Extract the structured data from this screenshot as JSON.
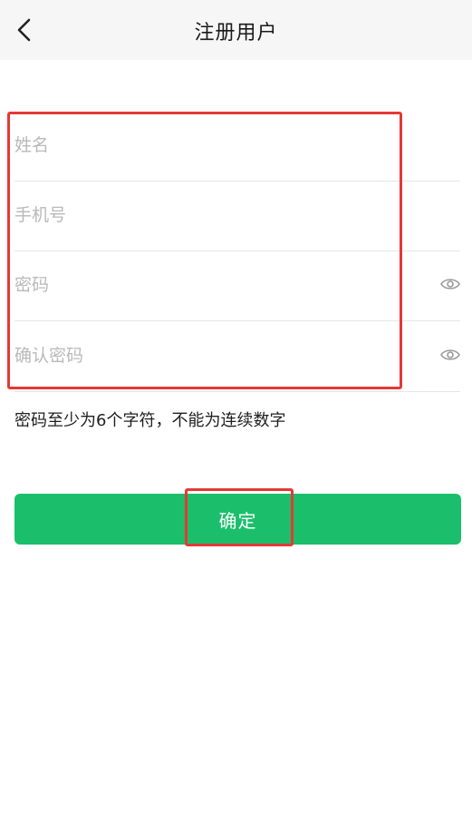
{
  "header": {
    "back_icon": "chevron-left-icon",
    "title": "注册用户"
  },
  "form": {
    "name_placeholder": "姓名",
    "phone_placeholder": "手机号",
    "password_placeholder": "密码",
    "confirm_password_placeholder": "确认密码",
    "eye_icon": "eye-icon"
  },
  "hint": "密码至少为6个字符，不能为连续数字",
  "submit_label": "确定",
  "colors": {
    "primary": "#1bbf6b",
    "highlight": "#e53935",
    "nav_bg": "#f6f6f6"
  }
}
